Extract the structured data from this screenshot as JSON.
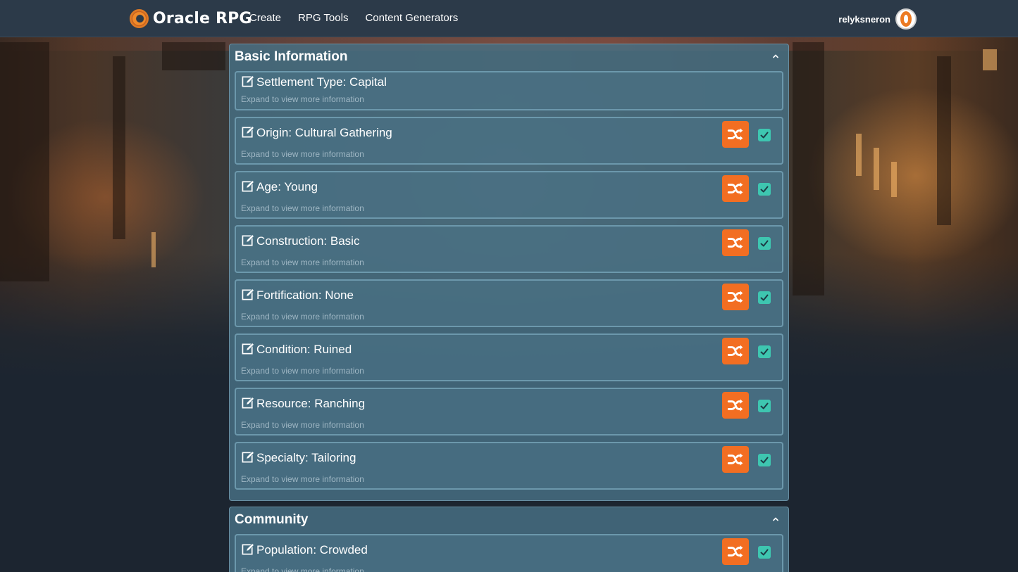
{
  "navbar": {
    "brand": "Oracle RPG",
    "links": [
      "Create",
      "RPG Tools",
      "Content Generators"
    ],
    "username": "relyksneron"
  },
  "sections": [
    {
      "title": "Basic Information",
      "items": [
        {
          "label": "Settlement Type: Capital",
          "sub": "Expand to view more information"
        },
        {
          "label": "Origin: Cultural Gathering",
          "sub": "Expand to view more information"
        },
        {
          "label": "Age: Young",
          "sub": "Expand to view more information"
        },
        {
          "label": "Construction: Basic",
          "sub": "Expand to view more information"
        },
        {
          "label": "Fortification: None",
          "sub": "Expand to view more information"
        },
        {
          "label": "Condition: Ruined",
          "sub": "Expand to view more information"
        },
        {
          "label": "Resource: Ranching",
          "sub": "Expand to view more information"
        },
        {
          "label": "Specialty: Tailoring",
          "sub": "Expand to view more information"
        }
      ]
    },
    {
      "title": "Community",
      "items": [
        {
          "label": "Population: Crowded",
          "sub": "Expand to view more information"
        }
      ]
    }
  ],
  "icons": {
    "edit": "edit-icon",
    "shuffle": "shuffle-icon",
    "check": "check-icon",
    "collapse": "chevron-up-icon"
  },
  "colors": {
    "accent": "#f26e22",
    "checkbox": "#3ec6b0",
    "navbar": "#2c3a49"
  }
}
